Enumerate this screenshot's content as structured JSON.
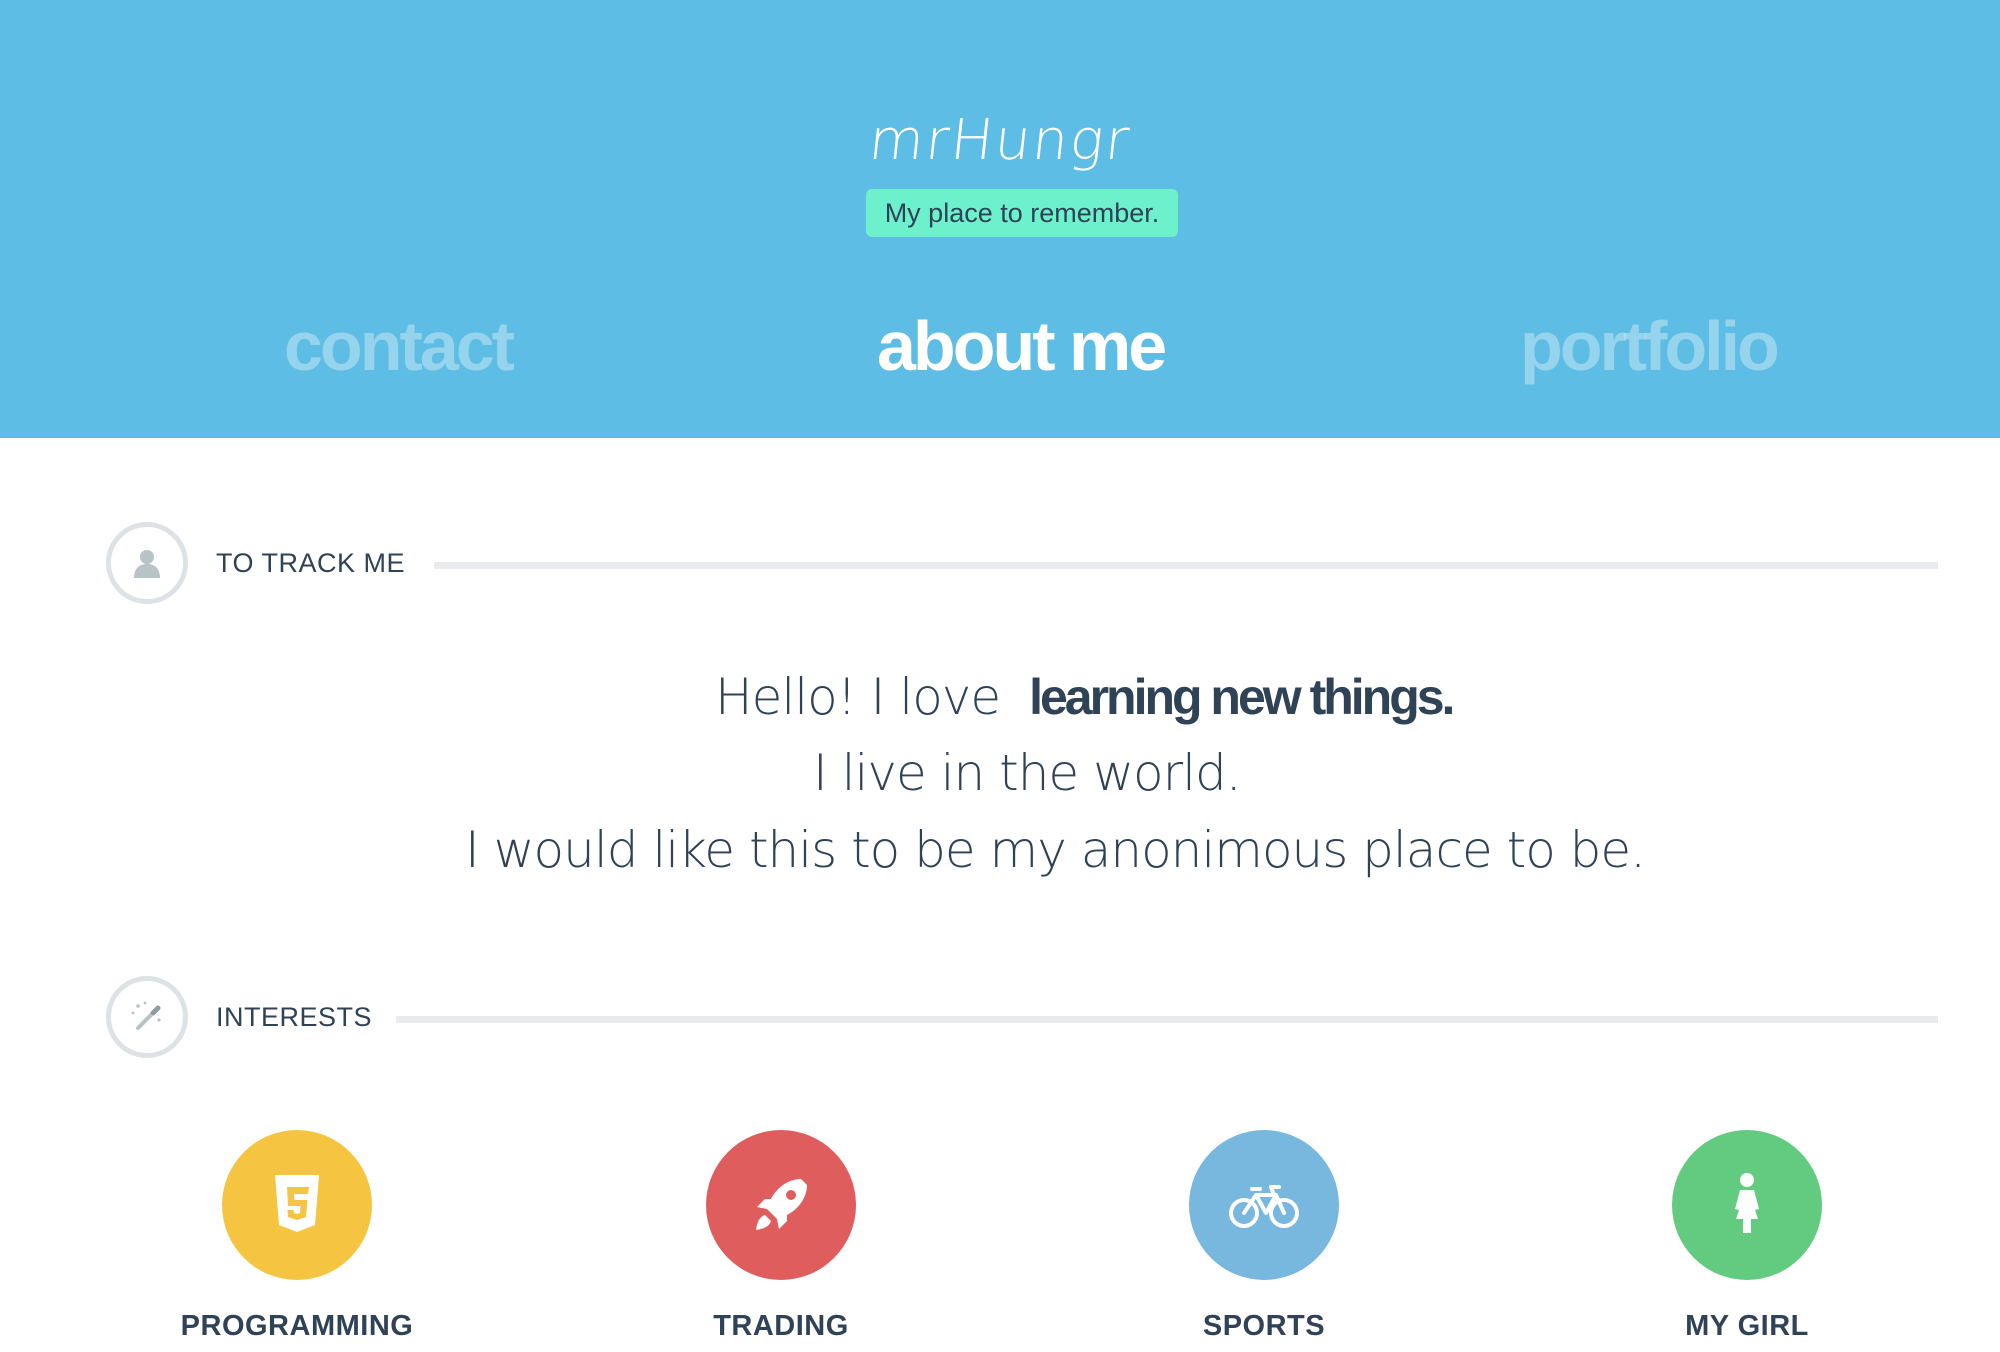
{
  "header": {
    "brand": "mrHungr",
    "tagline": "My place to remember.",
    "nav": [
      {
        "label": "contact",
        "active": false
      },
      {
        "label": "about me",
        "active": true
      },
      {
        "label": "portfolio",
        "active": false
      }
    ]
  },
  "sections": {
    "track": {
      "title": "TO TRACK ME",
      "icon": "user-icon"
    },
    "interests": {
      "title": "INTERESTS",
      "icon": "magic-wand-icon"
    }
  },
  "intro": {
    "line1_prefix": "Hello! I love",
    "line1_emphasis": "learning new things.",
    "line2": "I live in the world.",
    "line3": "I would like this to be my anonimous place to be."
  },
  "interests": [
    {
      "label": "PROGRAMMING",
      "icon": "html5-icon",
      "color": "#f5c542"
    },
    {
      "label": "TRADING",
      "icon": "rocket-icon",
      "color": "#e05d5d"
    },
    {
      "label": "SPORTS",
      "icon": "bicycle-icon",
      "color": "#78b8df"
    },
    {
      "label": "MY GIRL",
      "icon": "woman-icon",
      "color": "#62cb80"
    }
  ],
  "colors": {
    "header_bg": "#5ebde4",
    "tagline_bg": "#6cf1cc",
    "text_dark": "#2f4256",
    "rule": "#e8ecee"
  }
}
